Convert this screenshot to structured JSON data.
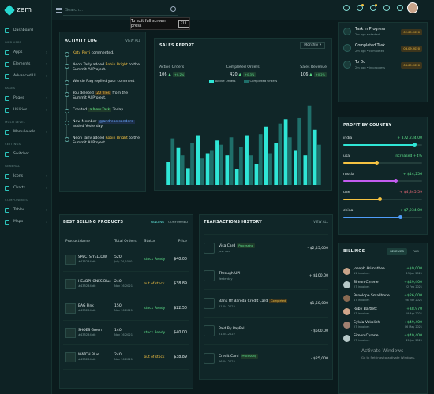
{
  "app": {
    "name": "zem",
    "search_placeholder": "Search...",
    "fullscreen_msg": "To exit full screen, press",
    "fullscreen_key": "F11"
  },
  "sidebar": {
    "top": [
      {
        "label": "Dashboard"
      }
    ],
    "web_apps_label": "WEB APPS",
    "web_apps": [
      {
        "label": "Apps"
      },
      {
        "label": "Elements"
      },
      {
        "label": "Advanced UI"
      }
    ],
    "pages_label": "PAGES",
    "pages": [
      {
        "label": "Pages"
      },
      {
        "label": "Utilities"
      }
    ],
    "multi_label": "MULTI LEVEL",
    "multi": [
      {
        "label": "Menu levels"
      }
    ],
    "settings_label": "SETTINGS",
    "settings": [
      {
        "label": "Switcher"
      }
    ],
    "general_label": "GENERAL",
    "general": [
      {
        "label": "Icons"
      },
      {
        "label": "Charts"
      }
    ],
    "components_label": "COMPONENTS",
    "components": [
      {
        "label": "Tables"
      },
      {
        "label": "Maps"
      }
    ]
  },
  "activity": {
    "title": "ACTIVITY LOG",
    "view_all": "VIEW ALL",
    "items": [
      {
        "p1": "Katy Perri",
        "p2": " commented.",
        "p3": "",
        "p4": ""
      },
      {
        "p1": "Neon Tarly",
        "p2": " added ",
        "p3": "Robin Bright",
        "p4": " to the Summit AI Project."
      },
      {
        "p1": "Wondo Rag",
        "p2": " replied your comment ",
        "p3": "",
        "p4": ""
      },
      {
        "p1": "You deleted ",
        "p2": "20 files",
        "p3": " from the Summit AI Project.",
        "p4": ""
      },
      {
        "p1": "Created ",
        "p2": "a New Task",
        "p3": " Today",
        "p4": ""
      },
      {
        "p1": "New Member ",
        "p2": "@andreas.sanders",
        "p3": " added Yesterday.",
        "p4": ""
      },
      {
        "p1": "Neon Tarly",
        "p2": " added ",
        "p3": "Robin Bright",
        "p4": " to the Summit AI Project."
      }
    ]
  },
  "sales": {
    "title": "SALES REPORT",
    "period": "Monthly",
    "kpis": [
      {
        "label": "Active Orders",
        "value": "106",
        "change": "+0.2%",
        "dir": "up"
      },
      {
        "label": "Completed Orders",
        "value": "420",
        "change": "+0.3%",
        "dir": "up"
      },
      {
        "label": "Sales Revenue",
        "value": "106",
        "change": "+0.2%",
        "dir": "up"
      }
    ],
    "legend": [
      "Active Orders",
      "Completed Orders"
    ]
  },
  "chart_data": {
    "type": "bar",
    "series": [
      {
        "name": "Active Orders",
        "values": [
          22,
          35,
          16,
          47,
          30,
          42,
          28,
          15,
          47,
          20,
          55,
          40,
          62,
          33,
          28,
          52
        ]
      },
      {
        "name": "Completed Orders",
        "values": [
          44,
          28,
          40,
          25,
          33,
          38,
          45,
          36,
          28,
          48,
          30,
          58,
          45,
          63,
          75,
          38
        ]
      }
    ],
    "colors": [
      "#2fe6d6",
      "#1f6f6a"
    ]
  },
  "tasks": {
    "items": [
      {
        "name": "Task in Progress",
        "meta": "2m ago • started",
        "date": "02.09.2020",
        "tone": "y"
      },
      {
        "name": "Completed Task",
        "meta": "2m ago • completed",
        "date": "03.09.2020",
        "tone": "y"
      },
      {
        "name": "To Do",
        "meta": "2m ago • in progress",
        "date": "06.09.2020",
        "tone": "y"
      }
    ]
  },
  "profit": {
    "title": "PROFIT BY COUNTRY",
    "rows": [
      {
        "country": "india",
        "value": "+ $72,234.00",
        "dir": "up",
        "pct": 0.9,
        "color": "#2fe6d6"
      },
      {
        "country": "usa",
        "value": "Increased +4%",
        "dir": "up",
        "pct": 0.42,
        "color": "#f5c242"
      },
      {
        "country": "russia",
        "value": "+ $14,256",
        "dir": "up",
        "pct": 0.66,
        "color": "#c35cf0"
      },
      {
        "country": "uae",
        "value": "+ $4,345.59",
        "dir": "dn",
        "pct": 0.46,
        "color": "#f5c242"
      },
      {
        "country": "china",
        "value": "+ $7,234.00",
        "dir": "up",
        "pct": 0.72,
        "color": "#4f9dfa"
      }
    ]
  },
  "billings": {
    "title": "BILLINGS",
    "tabs": [
      "RECEIVED",
      "PAID"
    ],
    "rows": [
      {
        "name": "Joseph Arimathea",
        "inv": "11 invoices",
        "amt": "+$9,000",
        "date": "15 Jan 2021",
        "color": "#c9a48a"
      },
      {
        "name": "Simon Cyrene",
        "inv": "27 invoices",
        "amt": "+$49,400",
        "date": "22 Feb 2021",
        "color": "#b7c9c9"
      },
      {
        "name": "Penelope Smallbone",
        "inv": "17 invoices",
        "amt": "+$26,000",
        "date": "08 Mar 2021",
        "color": "#8a6a52"
      },
      {
        "name": "Ruby Bartlett",
        "inv": "27 invoices",
        "amt": "+$8,970",
        "date": "19 Apr 2021",
        "color": "#d0a58a"
      },
      {
        "name": "Sylvia Vakolich",
        "inv": "27 invoices",
        "amt": "+$49,400",
        "date": "06 May 2021",
        "color": "#a08070"
      },
      {
        "name": "Simon Cyrene",
        "inv": "27 invoices",
        "amt": "+$49,400",
        "date": "21 Jun 2021",
        "color": "#b7c9c9"
      }
    ]
  },
  "best": {
    "title": "BEST SELLING PRODUCTS",
    "tabs": [
      "PANDING",
      "CONFORMED"
    ],
    "headers": [
      "ProductName",
      "Total Orders",
      "Status",
      "Price"
    ],
    "rows": [
      {
        "name": "SPECTS YELLOW",
        "id": "#435234.db",
        "orders": "520",
        "date": "July 24,2020",
        "status": "stock Ready",
        "tone": "ok",
        "price": "$40.00"
      },
      {
        "name": "HEADPHONES Blue",
        "id": "#435234.db",
        "orders": "240",
        "date": "Nov 16,2021",
        "status": "out of stock",
        "tone": "out",
        "price": "$38.89"
      },
      {
        "name": "BAG Pink",
        "id": "#435234.db",
        "orders": "150",
        "date": "Nov 16,2021",
        "status": "stock Ready",
        "tone": "ok",
        "price": "$22.50"
      },
      {
        "name": "SHOES Green",
        "id": "#435234.db",
        "orders": "140",
        "date": "Nov 16,2021",
        "status": "stock Ready",
        "tone": "ok",
        "price": "$40.00"
      },
      {
        "name": "WATCH Blue",
        "id": "#435234.db",
        "orders": "240",
        "date": "Nov 16,2021",
        "status": "out of stock",
        "tone": "out",
        "price": "$38.89"
      }
    ]
  },
  "transactions": {
    "title": "TRANSACTIONS HISTORY",
    "view_all": "VIEW ALL",
    "rows": [
      {
        "name": "Visa Card",
        "badge": "Processing",
        "tone": "g",
        "date": "Just now",
        "amt": "- $2,45,000"
      },
      {
        "name": "Through UPI",
        "badge": "",
        "tone": "",
        "date": "Yesterday",
        "amt": "+ $100.00"
      },
      {
        "name": "Bank Of Baroda Credit Card",
        "badge": "Completed",
        "tone": "y",
        "date": "21-04-2022",
        "amt": "- $1,50,000"
      },
      {
        "name": "Paid By PayPal",
        "badge": "",
        "tone": "",
        "date": "21-04-2022",
        "amt": "- $500.00"
      },
      {
        "name": "Credit Card",
        "badge": "Processing",
        "tone": "g",
        "date": "26-04-2022",
        "amt": "- $25,000"
      }
    ]
  },
  "watermark": {
    "line1": "Activate Windows",
    "line2": "Go to Settings to activate Windows."
  }
}
